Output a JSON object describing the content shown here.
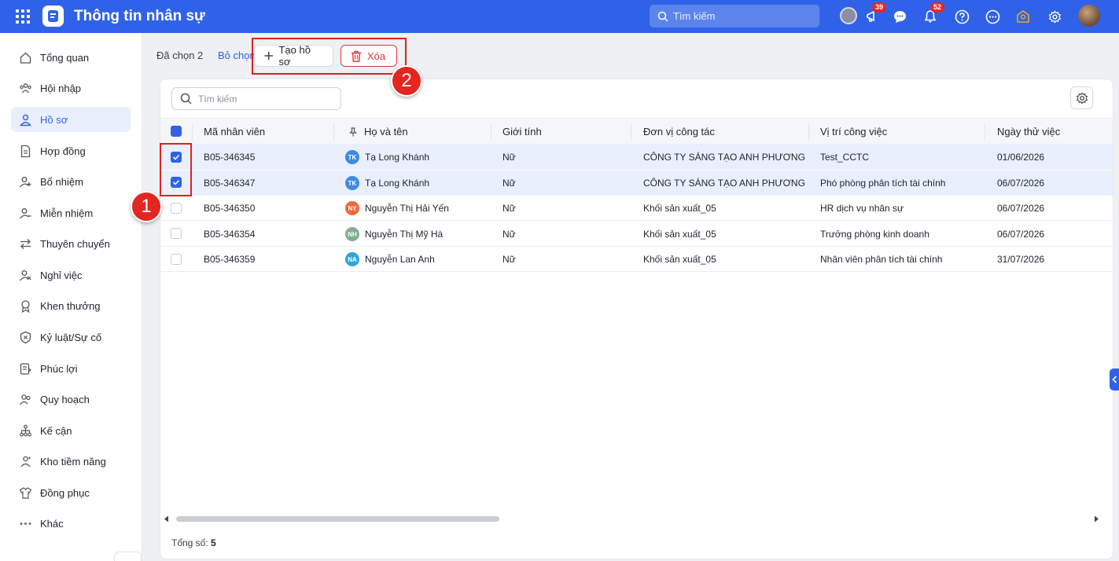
{
  "header": {
    "title": "Thông tin nhân sự",
    "search_placeholder": "Tìm kiếm",
    "announce_badge": "39",
    "notify_badge": "52"
  },
  "sidebar": {
    "items": [
      {
        "label": "Tổng quan",
        "icon": "home-icon"
      },
      {
        "label": "Hội nhập",
        "icon": "people-icon"
      },
      {
        "label": "Hồ sơ",
        "icon": "profile-icon",
        "active": true
      },
      {
        "label": "Hợp đồng",
        "icon": "contract-icon"
      },
      {
        "label": "Bổ nhiệm",
        "icon": "appoint-icon"
      },
      {
        "label": "Miễn nhiệm",
        "icon": "dismiss-icon"
      },
      {
        "label": "Thuyên chuyển",
        "icon": "transfer-icon"
      },
      {
        "label": "Nghỉ việc",
        "icon": "resign-icon"
      },
      {
        "label": "Khen thưởng",
        "icon": "reward-icon"
      },
      {
        "label": "Kỷ luật/Sự cố",
        "icon": "discipline-icon"
      },
      {
        "label": "Phúc lợi",
        "icon": "welfare-icon"
      },
      {
        "label": "Quy hoạch",
        "icon": "planning-icon"
      },
      {
        "label": "Kế cận",
        "icon": "succession-icon"
      },
      {
        "label": "Kho tiềm năng",
        "icon": "talent-pool-icon"
      },
      {
        "label": "Đồng phục",
        "icon": "uniform-icon"
      },
      {
        "label": "Khác",
        "icon": "more-icon"
      }
    ]
  },
  "actions": {
    "selected_text": "Đã chọn 2",
    "unselect_label": "Bỏ chọn",
    "create_label": "Tạo hồ sơ",
    "delete_label": "Xóa"
  },
  "annotations": {
    "step1": "1",
    "step2": "2"
  },
  "table": {
    "search_placeholder": "Tìm kiếm",
    "columns": [
      "Mã nhân viên",
      "Họ và tên",
      "Giới tính",
      "Đơn vị công tác",
      "Vị trí công việc",
      "Ngày thử việc"
    ],
    "rows": [
      {
        "id": "B05-346345",
        "initials": "TK",
        "avatar_color": "#3d8be0",
        "name": "Tạ Long Khánh",
        "gender": "Nữ",
        "unit": "CÔNG TY SÁNG TẠO ANH PHƯƠNG",
        "position": "Test_CCTC",
        "date": "01/06/2026",
        "checked": true
      },
      {
        "id": "B05-346347",
        "initials": "TK",
        "avatar_color": "#3d8be0",
        "name": "Tạ Long Khánh",
        "gender": "Nữ",
        "unit": "CÔNG TY SÁNG TẠO ANH PHƯƠNG",
        "position": "Phó phòng phân tích tài chính",
        "date": "06/07/2026",
        "checked": true
      },
      {
        "id": "B05-346350",
        "initials": "NY",
        "avatar_color": "#f0683a",
        "name": "Nguyễn Thị Hải Yến",
        "gender": "Nữ",
        "unit": "Khối sản xuất_05",
        "position": "HR dịch vụ nhân sự",
        "date": "06/07/2026",
        "checked": false
      },
      {
        "id": "B05-346354",
        "initials": "NH",
        "avatar_color": "#7fae8e",
        "name": "Nguyễn Thị Mỹ Hà",
        "gender": "Nữ",
        "unit": "Khối sản xuất_05",
        "position": "Trưởng phòng kinh doanh",
        "date": "06/07/2026",
        "checked": false
      },
      {
        "id": "B05-346359",
        "initials": "NA",
        "avatar_color": "#2fa6db",
        "name": "Nguyễn Lan Anh",
        "gender": "Nữ",
        "unit": "Khối sản xuất_05",
        "position": "Nhân viên phân tích tài chính",
        "date": "31/07/2026",
        "checked": false
      }
    ],
    "total_label": "Tổng số:",
    "total_value": "5"
  }
}
